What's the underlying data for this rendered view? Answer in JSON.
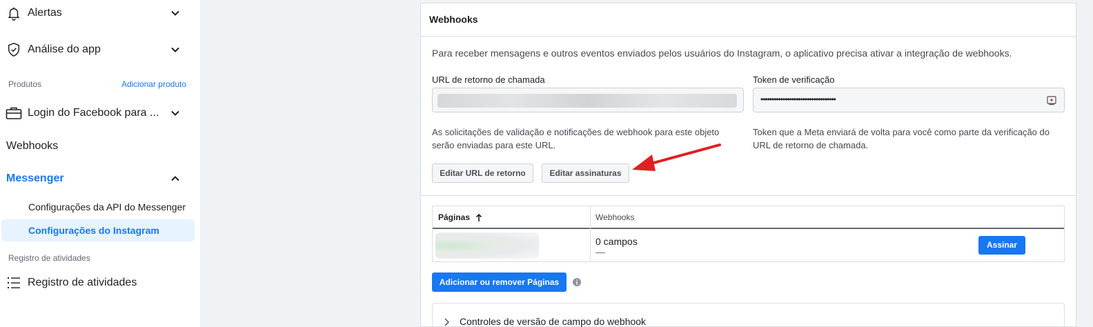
{
  "sidebar": {
    "alertas": {
      "label": "Alertas",
      "icon": "bell-icon"
    },
    "analise": {
      "label": "Análise do app",
      "icon": "shield-check-icon"
    },
    "produtos_section": {
      "label": "Produtos",
      "link": "Adicionar produto"
    },
    "login_fb": {
      "label": "Login do Facebook para ...",
      "icon": "briefcase-icon"
    },
    "webhooks": {
      "label": "Webhooks"
    },
    "messenger": {
      "label": "Messenger"
    },
    "messenger_sub": [
      {
        "label": "Configurações da API do Messenger"
      },
      {
        "label": "Configurações do Instagram",
        "active": true
      }
    ],
    "registro_section": {
      "label": "Registro de atividades"
    },
    "registro": {
      "label": "Registro de atividades",
      "icon": "list-icon"
    }
  },
  "panel": {
    "title": "Webhooks",
    "description": "Para receber mensagens e outros eventos enviados pelos usuários do Instagram, o aplicativo precisa ativar a integração de webhooks.",
    "callback_url": {
      "label": "URL de retorno de chamada",
      "help": "As solicitações de validação e notificações de webhook para este objeto serão enviadas para este URL."
    },
    "verify_token": {
      "label": "Token de verificação",
      "value": "••••••••••••••••••••••••••••••••••",
      "help": "Token que a Meta enviará de volta para você como parte da verificação do URL de retorno de chamada."
    },
    "buttons": {
      "edit_url": "Editar URL de retorno",
      "edit_subscriptions": "Editar assinaturas"
    },
    "table": {
      "headers": {
        "pages": "Páginas",
        "webhooks": "Webhooks"
      },
      "rows": [
        {
          "fields": "0 campos",
          "dash": "—",
          "action": "Assinar"
        }
      ]
    },
    "add_remove_pages": "Adicionar ou remover Páginas",
    "collapsible": "Controles de versão de campo do webhook"
  },
  "colors": {
    "accent": "#1877f2",
    "arrow": "#e02020"
  }
}
